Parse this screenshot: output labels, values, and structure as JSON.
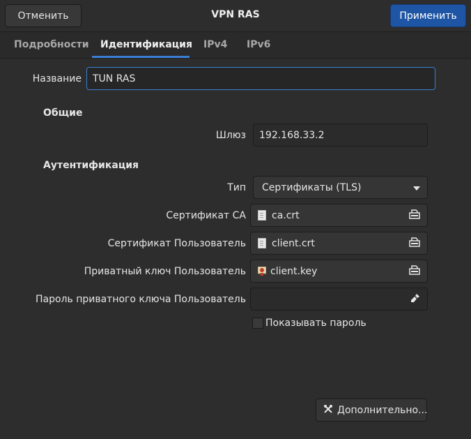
{
  "header": {
    "cancel_label": "Отменить",
    "title": "VPN RAS",
    "apply_label": "Применить"
  },
  "tabs": [
    {
      "label": "Подробности",
      "active": false
    },
    {
      "label": "Идентификация",
      "active": true
    },
    {
      "label": "IPv4",
      "active": false
    },
    {
      "label": "IPv6",
      "active": false
    }
  ],
  "form": {
    "name_label": "Название",
    "name_value": "TUN RAS",
    "general_section": "Общие",
    "gateway_label": "Шлюз",
    "gateway_value": "192.168.33.2",
    "auth_section": "Аутентификация",
    "type_label": "Тип",
    "type_value": "Сертификаты (TLS)",
    "ca_label": "Сертификат CA",
    "ca_file": "ca.crt",
    "user_cert_label": "Сертификат Пользователь",
    "user_cert_file": "client.crt",
    "private_key_label": "Приватный ключ Пользователь",
    "private_key_file": "client.key",
    "key_password_label": "Пароль приватного ключа Пользователь",
    "key_password_value": "",
    "show_password_label": "Показывать пароль",
    "show_password_checked": false,
    "advanced_label": "Дополнительно..."
  },
  "colors": {
    "accent": "#3b7fd3",
    "apply_button": "#1e55a4",
    "background": "#2d2d2d"
  },
  "icons": {
    "file": "file-icon",
    "key": "certificate-key-icon",
    "file_chooser": "file-chooser-icon",
    "clear": "clear-brush-icon",
    "dropdown": "chevron-down-icon",
    "tools": "tools-icon"
  }
}
